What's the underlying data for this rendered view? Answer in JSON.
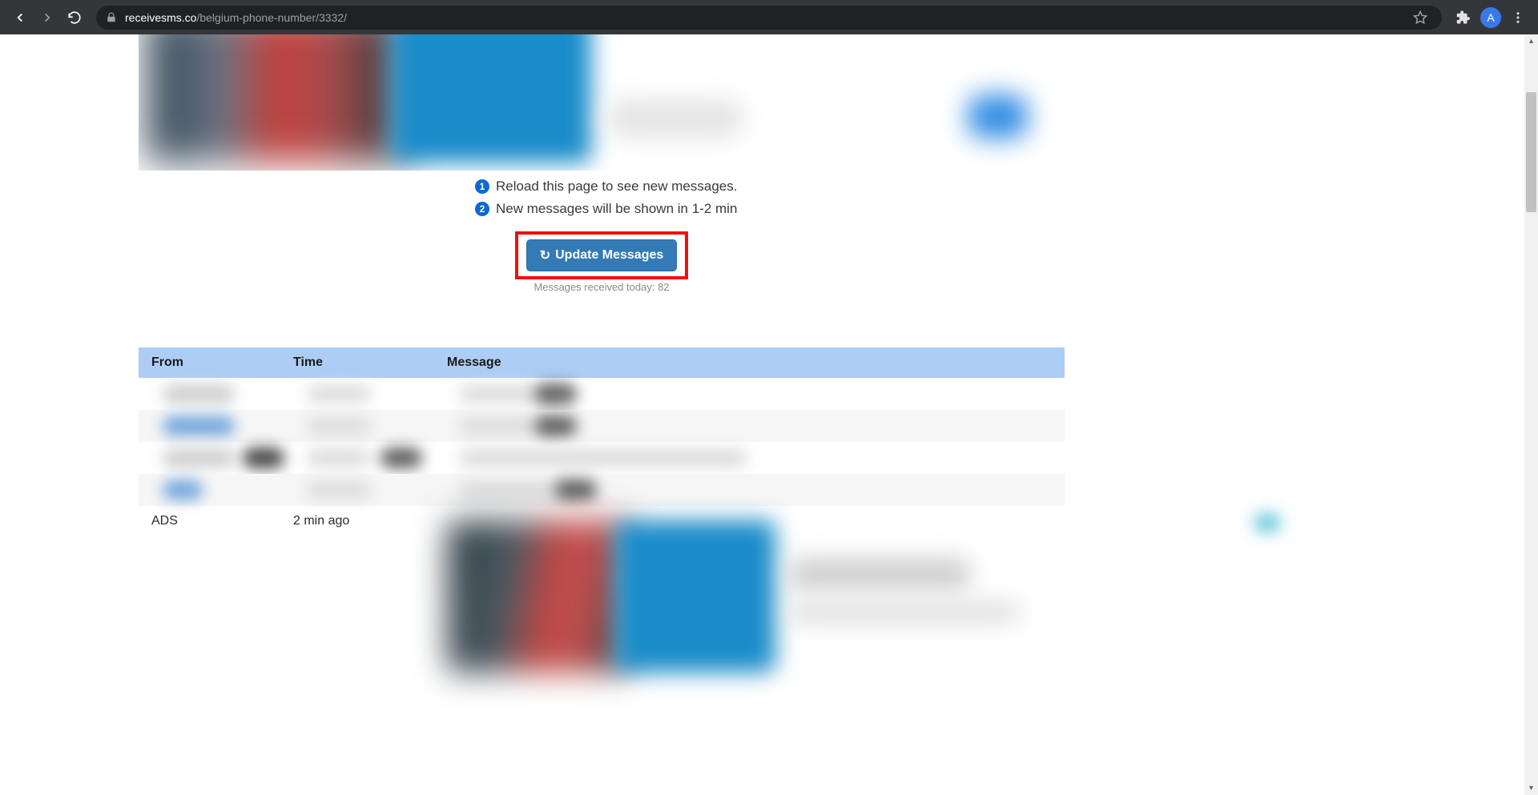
{
  "browser": {
    "url_domain": "receivesms.co",
    "url_path": "/belgium-phone-number/3332/",
    "avatar_letter": "A"
  },
  "info": {
    "line1_num": "1",
    "line1_text": "Reload this page to see new messages.",
    "line2_num": "2",
    "line2_text": "New messages will be shown in 1-2 min"
  },
  "update": {
    "button_label": "Update Messages",
    "count_text": "Messages received today: 82"
  },
  "table": {
    "headers": {
      "from": "From",
      "time": "Time",
      "message": "Message"
    },
    "ads_row": {
      "from": "ADS",
      "time": "2 min ago"
    }
  }
}
